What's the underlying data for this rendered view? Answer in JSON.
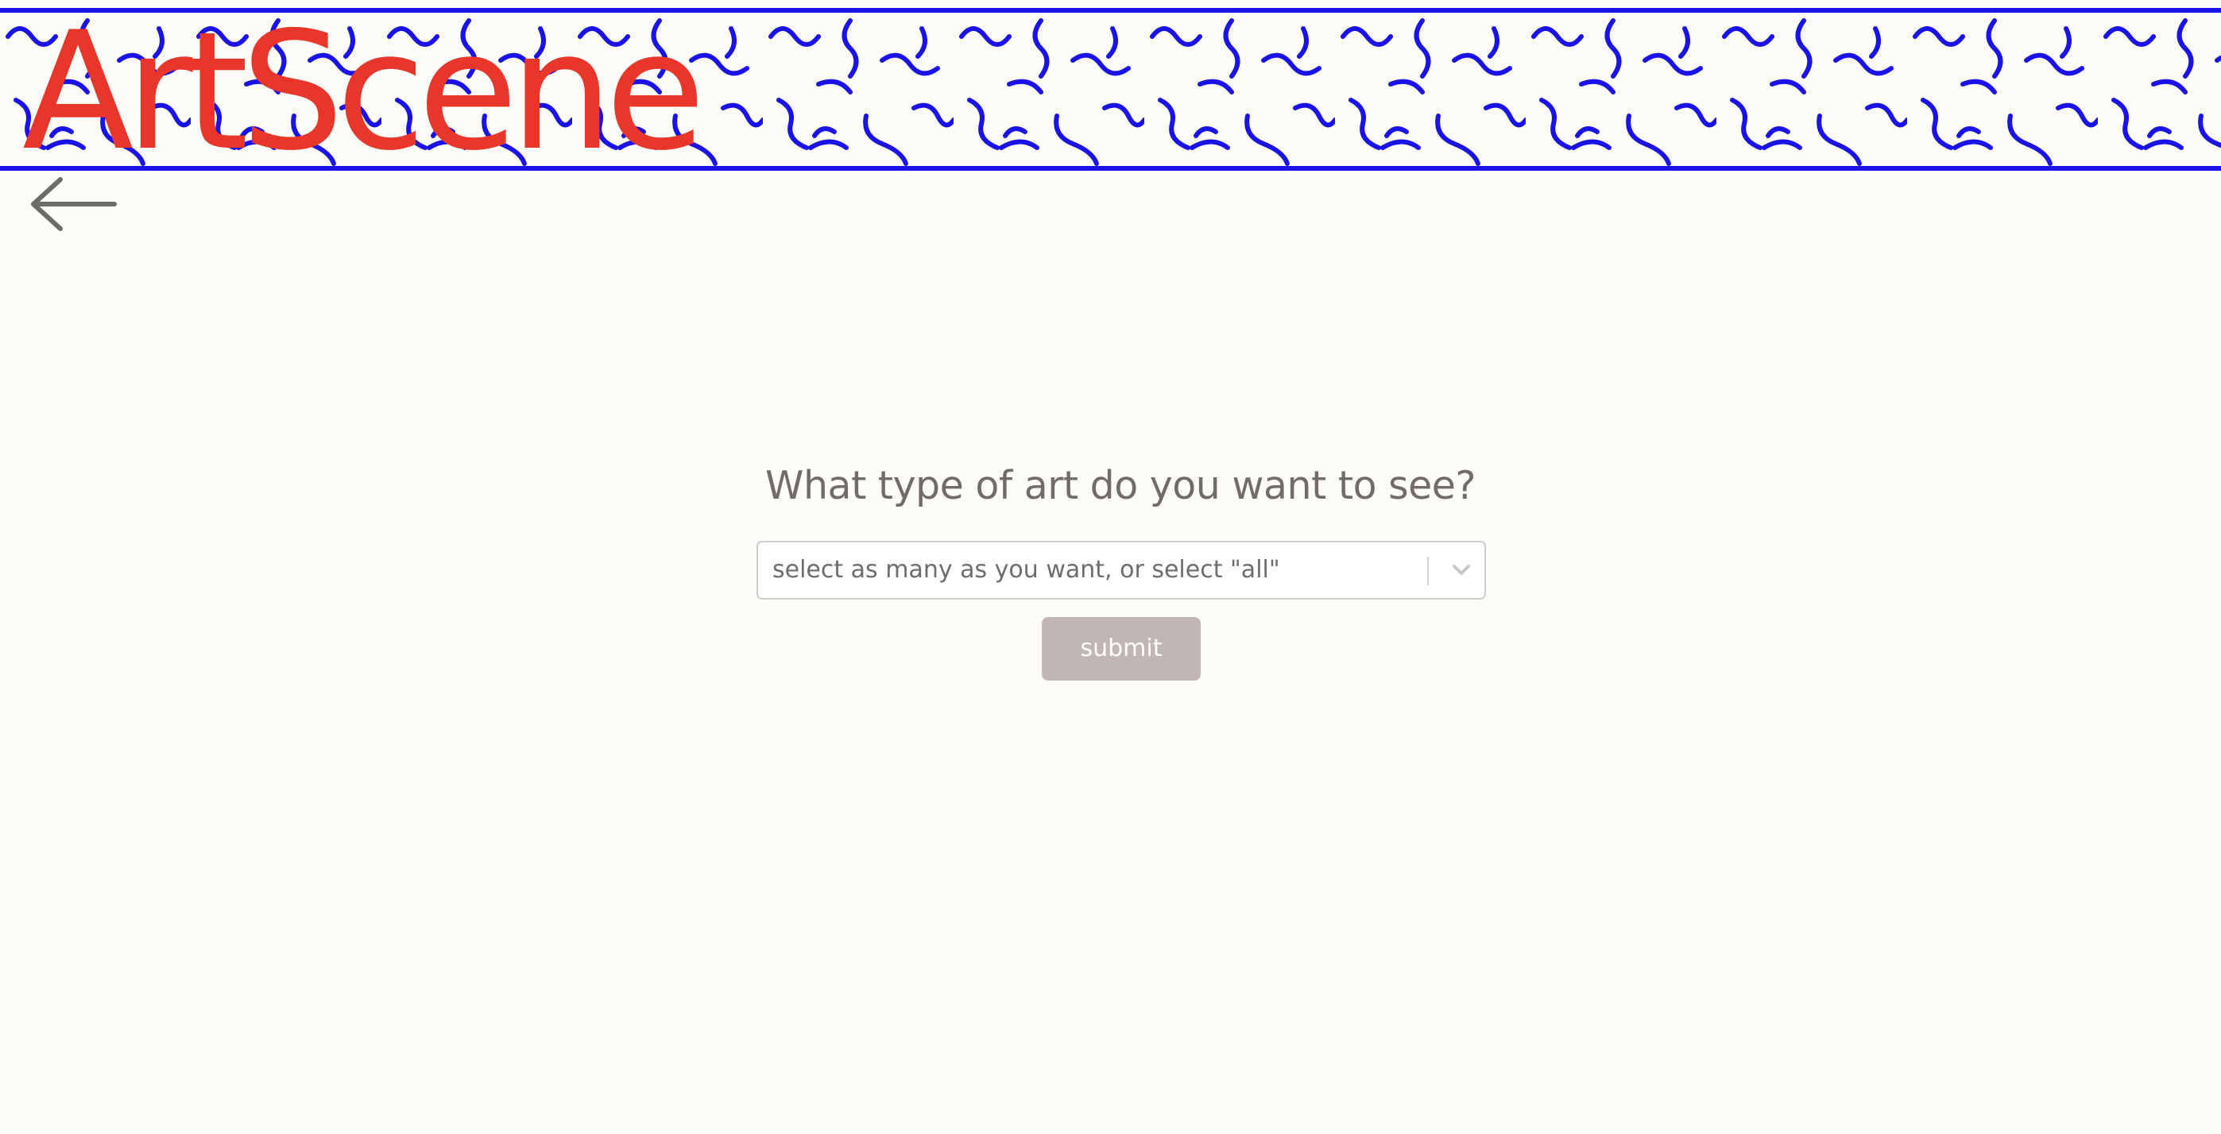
{
  "header": {
    "logo_text": "ArtScene",
    "logo_color": "#e8372a",
    "pattern_color": "#1a12e6"
  },
  "nav": {
    "back_icon": "arrow-left-icon"
  },
  "form": {
    "question": "What type of art do you want to see?",
    "select": {
      "placeholder": "select as many as you want, or select \"all\"",
      "dropdown_icon": "chevron-down-icon"
    },
    "submit_label": "submit"
  }
}
